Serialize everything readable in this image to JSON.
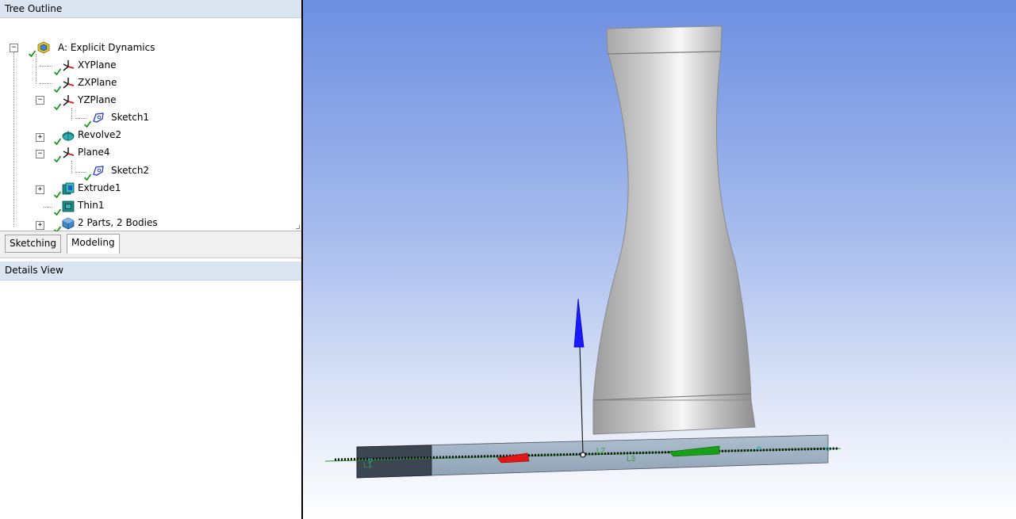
{
  "tree_outline": {
    "title": "Tree Outline",
    "nodes": [
      {
        "label": "A: Explicit Dynamics",
        "icon": "geometry-root-icon",
        "expander": "−"
      },
      {
        "label": "XYPlane",
        "icon": "plane-axes-icon"
      },
      {
        "label": "ZXPlane",
        "icon": "plane-axes-icon"
      },
      {
        "label": "YZPlane",
        "icon": "plane-axes-icon",
        "expander": "−"
      },
      {
        "label": "Sketch1",
        "icon": "sketch-icon"
      },
      {
        "label": "Revolve2",
        "icon": "revolve-icon",
        "expander": "+"
      },
      {
        "label": "Plane4",
        "icon": "plane-axes-icon",
        "expander": "−"
      },
      {
        "label": "Sketch2",
        "icon": "sketch-icon"
      },
      {
        "label": "Extrude1",
        "icon": "extrude-icon",
        "expander": "+"
      },
      {
        "label": "Thin1",
        "icon": "thin-icon"
      },
      {
        "label": "2 Parts, 2 Bodies",
        "icon": "parts-bodies-icon",
        "expander": "+"
      }
    ]
  },
  "tabs": {
    "sketching": "Sketching",
    "modeling": "Modeling",
    "active": "modeling"
  },
  "details_view": {
    "title": "Details View"
  },
  "viewport": {
    "line_labels": [
      "L1",
      "L2",
      "L3"
    ],
    "colors": {
      "bg_top": "#6d8fe0",
      "bg_bottom": "#ffffff",
      "body": "#c8c8c8",
      "beam": "#9fb3c6",
      "z_axis": "#1a1aff",
      "x_axis": "#e01818",
      "y_axis": "#18a018"
    }
  }
}
